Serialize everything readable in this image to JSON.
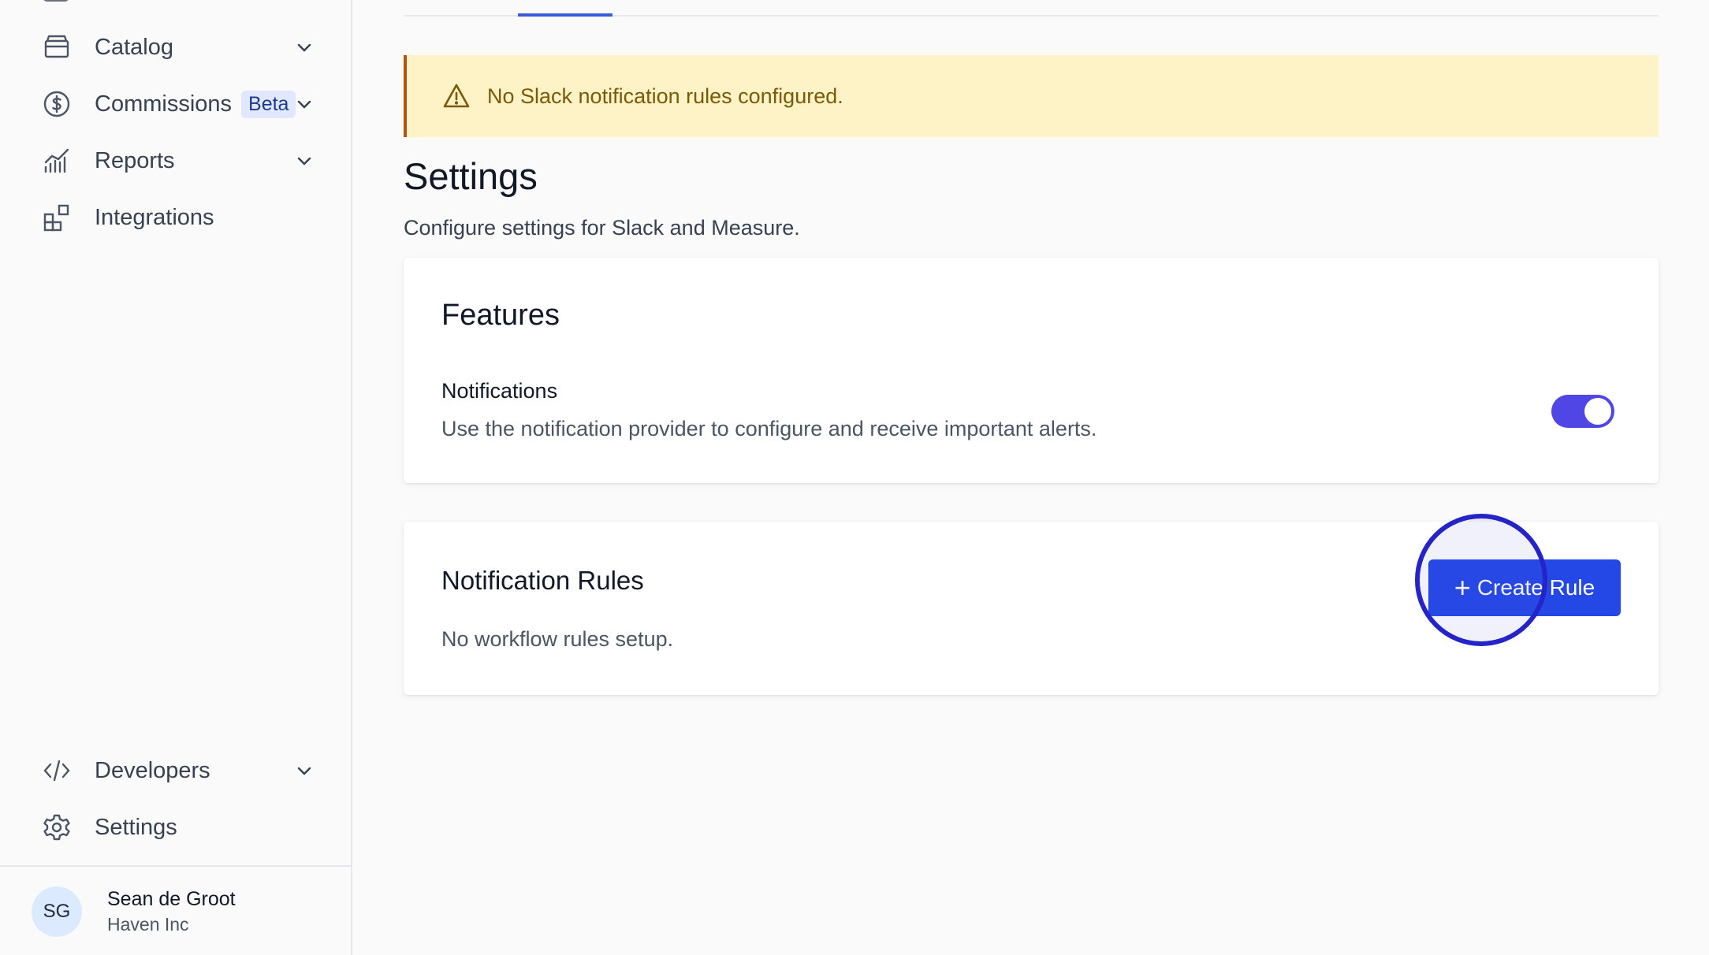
{
  "sidebar": {
    "items": [
      {
        "label": "Catalog",
        "icon": "archive-icon",
        "chevron": true
      },
      {
        "label": "Commissions",
        "icon": "dollar-icon",
        "badge": "Beta",
        "chevron": true
      },
      {
        "label": "Reports",
        "icon": "chart-icon",
        "chevron": true
      },
      {
        "label": "Integrations",
        "icon": "grid-plus-icon",
        "chevron": false
      }
    ],
    "bottom_items": [
      {
        "label": "Developers",
        "icon": "code-icon",
        "chevron": true
      },
      {
        "label": "Settings",
        "icon": "gear-icon",
        "chevron": false
      }
    ],
    "user": {
      "initials": "SG",
      "name": "Sean de Groot",
      "org": "Haven Inc"
    }
  },
  "main": {
    "alert": {
      "text": "No Slack notification rules configured.",
      "icon": "warning-icon"
    },
    "title": "Settings",
    "subtitle": "Configure settings for Slack and Measure.",
    "features": {
      "title": "Features",
      "notifications": {
        "name": "Notifications",
        "description": "Use the notification provider to configure and receive important alerts.",
        "enabled": true
      }
    },
    "rules": {
      "title": "Notification Rules",
      "empty": "No workflow rules setup.",
      "create_label": "Create Rule"
    }
  },
  "colors": {
    "accent": "#2448e6",
    "toggle": "#4f46e5",
    "alert_bg": "#fef3c7",
    "alert_text": "#7c5a05"
  }
}
